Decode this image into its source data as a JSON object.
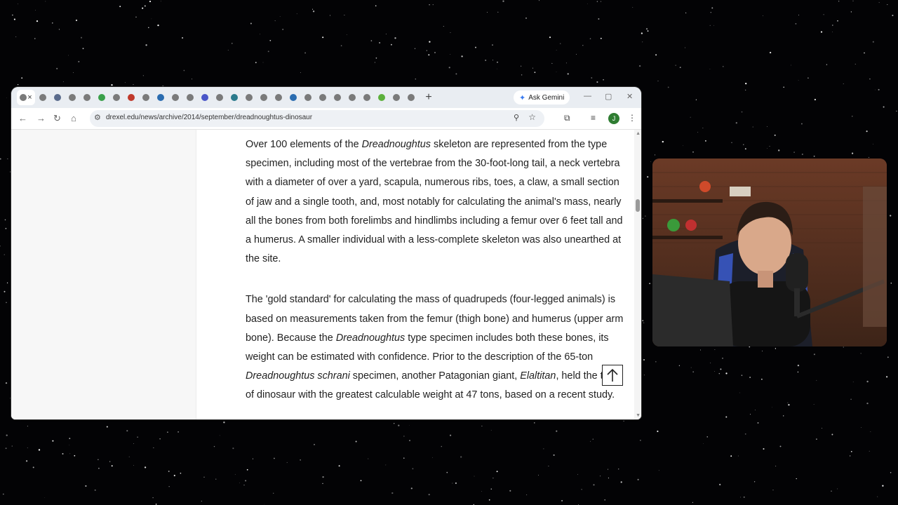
{
  "browser": {
    "tab_favicon_colors": [
      "#7a7a7a",
      "#7a7a7a",
      "#5a6b8c",
      "#7a7a7a",
      "#7a7a7a",
      "#3aa04a",
      "#7a7a7a",
      "#c0392b",
      "#7a7a7a",
      "#2b6cb0",
      "#7a7a7a",
      "#7a7a7a",
      "#4a56c8",
      "#7a7a7a",
      "#2b7a8c",
      "#7a7a7a",
      "#7a7a7a",
      "#7a7a7a",
      "#2b6cb0",
      "#7a7a7a",
      "#7a7a7a",
      "#7a7a7a",
      "#7a7a7a",
      "#7a7a7a",
      "#5cb03c",
      "#7a7a7a",
      "#7a7a7a"
    ],
    "close_tab": "×",
    "new_tab": "+",
    "gemini_label": "Ask Gemini",
    "url": "drexel.edu/news/archive/2014/september/dreadnoughtus-dinosaur",
    "avatar_letter": "J"
  },
  "article": {
    "p1": {
      "a": "Over 100 elements of the ",
      "b": "Dreadnoughtus",
      "c": " skeleton are represented from the type specimen, including most of the vertebrae from the 30-foot-long tail, a neck vertebra with a diameter of over a yard, scapula, numerous ribs, toes, a claw, a small section of jaw and a single tooth, and, most notably for calculating the animal's mass, nearly all the bones from both forelimbs and hindlimbs including a femur over 6 feet tall and a humerus. A smaller individual with a less-complete skeleton was also unearthed at the site."
    },
    "p2": {
      "a": "The 'gold standard' for calculating the mass of quadrupeds (four-legged animals) is based on measurements taken from the femur (thigh bone) and humerus (upper arm bone). Because the ",
      "b": "Dreadnoughtus",
      "c": " type specimen includes both these bones, its weight can be estimated with confidence. Prior to the description of the 65-ton ",
      "d": "Dreadnoughtus schrani",
      "e": " specimen, another Patagonian giant, ",
      "f": "Elaltitan",
      "g": ", held the title of dinosaur with the greatest calculable weight at 47 tons, based on a recent study."
    }
  },
  "scrollbar": {
    "position": 0.27
  }
}
